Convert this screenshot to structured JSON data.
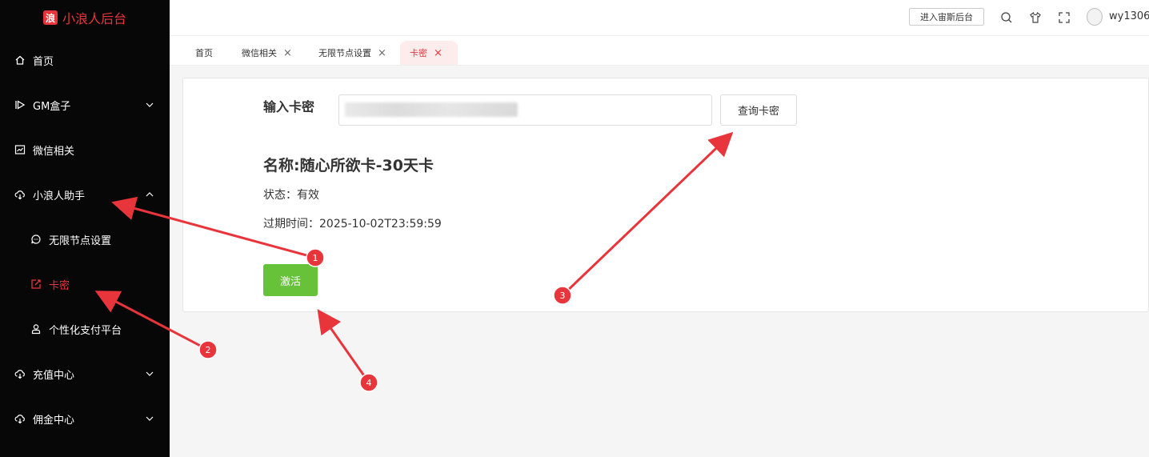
{
  "sidebar": {
    "logo_glyph": "浪",
    "logo_text": "小浪人后台",
    "items": [
      {
        "label": "首页",
        "icon": "home-icon"
      },
      {
        "label": "GM盒子",
        "icon": "play-icon"
      },
      {
        "label": "微信相关",
        "icon": "chart-icon"
      },
      {
        "label": "小浪人助手",
        "icon": "cloud-icon"
      },
      {
        "label": "无限节点设置",
        "icon": "chat-icon"
      },
      {
        "label": "卡密",
        "icon": "edit-icon"
      },
      {
        "label": "个性化支付平台",
        "icon": "user-icon"
      },
      {
        "label": "充值中心",
        "icon": "cloud-icon"
      },
      {
        "label": "佣金中心",
        "icon": "cloud-icon"
      }
    ]
  },
  "header": {
    "enter_button": "进入宙斯后台",
    "username": "wy1306"
  },
  "tabs": [
    {
      "label": "首页"
    },
    {
      "label": "微信相关"
    },
    {
      "label": "无限节点设置"
    },
    {
      "label": "卡密"
    }
  ],
  "tab_close_glyph": "×",
  "card": {
    "input_label": "输入卡密",
    "input_value": "",
    "query_button": "查询卡密",
    "name": "名称:随心所欲卡-30天卡",
    "status": "状态：有效",
    "expire": "过期时间：2025-10-02T23:59:59",
    "activate_button": "激活"
  },
  "annotations": [
    "1",
    "2",
    "3",
    "4"
  ],
  "colors": {
    "accent": "#e8353b",
    "sidebar_bg": "#070707",
    "success": "#67c23a"
  }
}
